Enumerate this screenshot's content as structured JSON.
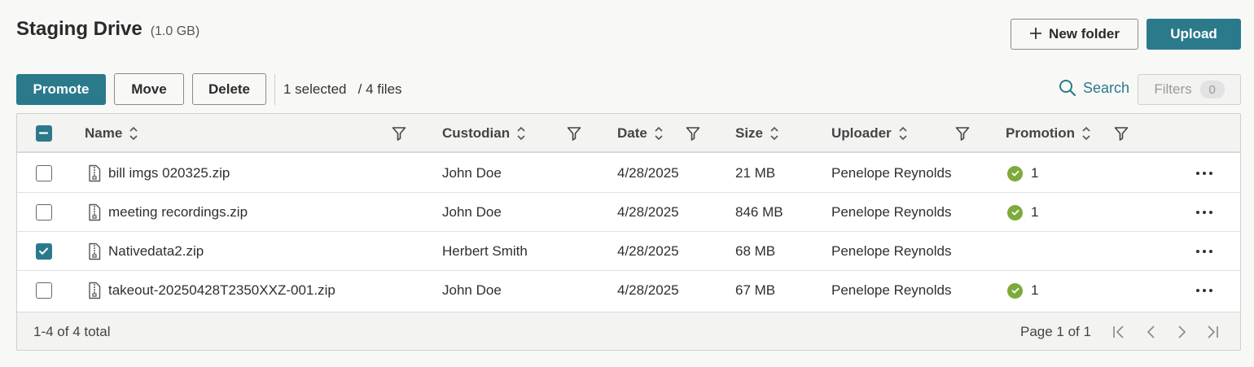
{
  "header": {
    "title": "Staging Drive",
    "size": "(1.0 GB)",
    "new_folder_label": "New folder",
    "upload_label": "Upload"
  },
  "toolbar": {
    "promote_label": "Promote",
    "move_label": "Move",
    "delete_label": "Delete",
    "selected_text": "1 selected",
    "files_text": "/ 4 files",
    "search_label": "Search",
    "filters_label": "Filters",
    "filters_count": "0"
  },
  "table": {
    "columns": {
      "name": "Name",
      "custodian": "Custodian",
      "date": "Date",
      "size": "Size",
      "uploader": "Uploader",
      "promotion": "Promotion"
    },
    "rows": [
      {
        "name": "bill imgs 020325.zip",
        "custodian": "John Doe",
        "date": "4/28/2025",
        "size": "21 MB",
        "uploader": "Penelope Reynolds",
        "promotion": "1",
        "selected": false
      },
      {
        "name": "meeting recordings.zip",
        "custodian": "John Doe",
        "date": "4/28/2025",
        "size": "846 MB",
        "uploader": "Penelope Reynolds",
        "promotion": "1",
        "selected": false
      },
      {
        "name": "Nativedata2.zip",
        "custodian": "Herbert Smith",
        "date": "4/28/2025",
        "size": "68 MB",
        "uploader": "Penelope Reynolds",
        "promotion": "",
        "selected": true
      },
      {
        "name": "takeout-20250428T2350XXZ-001.zip",
        "custodian": "John Doe",
        "date": "4/28/2025",
        "size": "67 MB",
        "uploader": "Penelope Reynolds",
        "promotion": "1",
        "selected": false
      }
    ]
  },
  "footer": {
    "total": "1-4 of 4 total",
    "page": "Page 1 of 1"
  },
  "colors": {
    "accent": "#2a7a8c",
    "success": "#7daa3a"
  },
  "icons": {
    "new_folder": "plus-icon",
    "search": "search-icon",
    "file": "zip-file-icon",
    "filter": "filter-icon",
    "sort": "sort-icon",
    "promotion": "check-circle-icon",
    "more": "more-icon"
  }
}
